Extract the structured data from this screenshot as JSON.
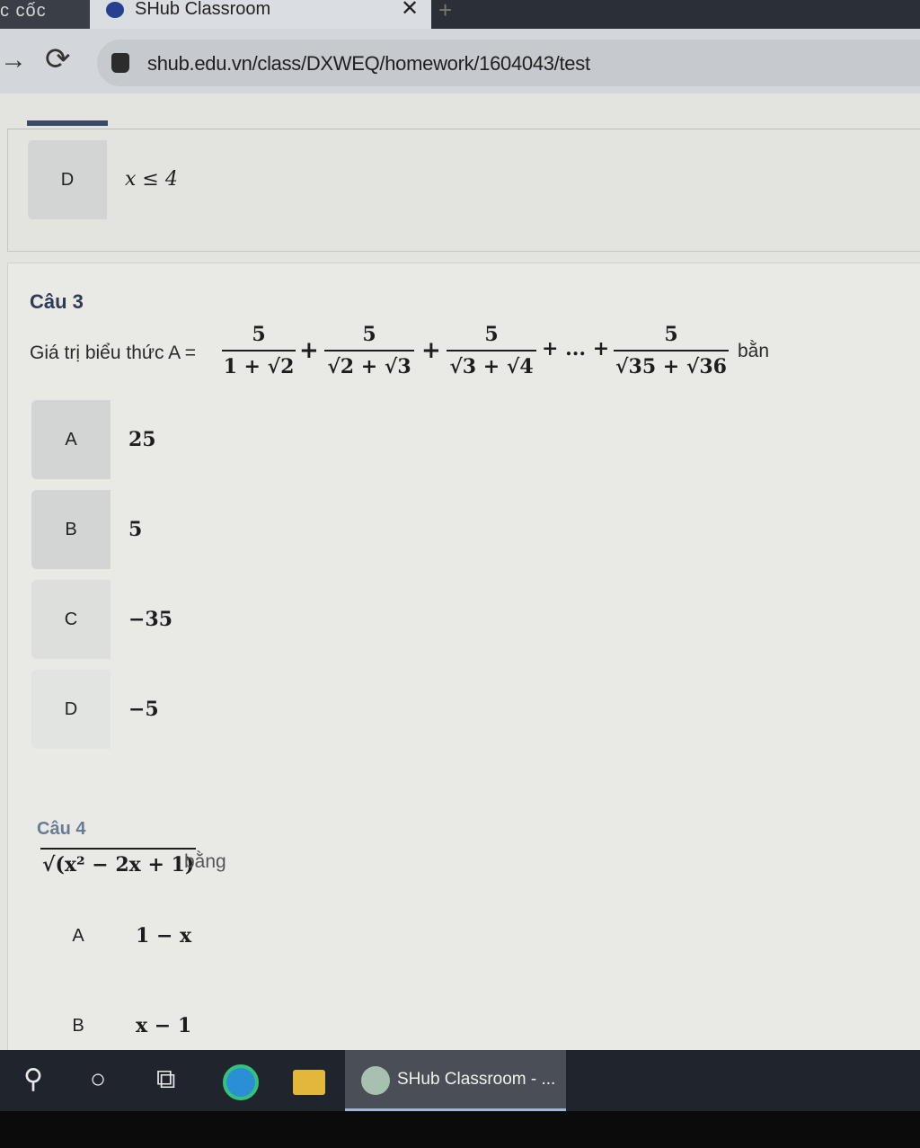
{
  "browser": {
    "prev_tab_label": "c cốc",
    "active_tab_title": "SHub Classroom",
    "close_glyph": "✕",
    "new_tab_glyph": "+",
    "url": "shub.edu.vn/class/DXWEQ/homework/1604043/test"
  },
  "prev_question": {
    "option_d": {
      "letter": "D",
      "value": "x ≤ 4"
    }
  },
  "question3": {
    "title": "Câu 3",
    "stem_prefix": "Giá trị biểu thức A =",
    "fractions": [
      {
        "num": "5",
        "den": "1 + √2"
      },
      {
        "num": "5",
        "den": "√2 + √3"
      },
      {
        "num": "5",
        "den": "√3 + √4"
      },
      {
        "num": "5",
        "den": "√35 + √36"
      }
    ],
    "plus1": "+",
    "plus2": "+",
    "ellipsis": "+ ... +",
    "stem_suffix": "bằn",
    "options": [
      {
        "letter": "A",
        "value": "25"
      },
      {
        "letter": "B",
        "value": "5"
      },
      {
        "letter": "C",
        "value": "−35"
      },
      {
        "letter": "D",
        "value": "−5"
      }
    ]
  },
  "question4": {
    "title": "Câu 4",
    "expr": "√(x² − 2x + 1)",
    "suffix": "bằng",
    "options": [
      {
        "letter": "A",
        "value": "1 − x"
      },
      {
        "letter": "B",
        "value": "x − 1"
      }
    ]
  },
  "taskbar": {
    "search_glyph": "⚲",
    "cortana_glyph": "○",
    "taskview_glyph": "⧉",
    "app_label": "SHub Classroom - ..."
  }
}
